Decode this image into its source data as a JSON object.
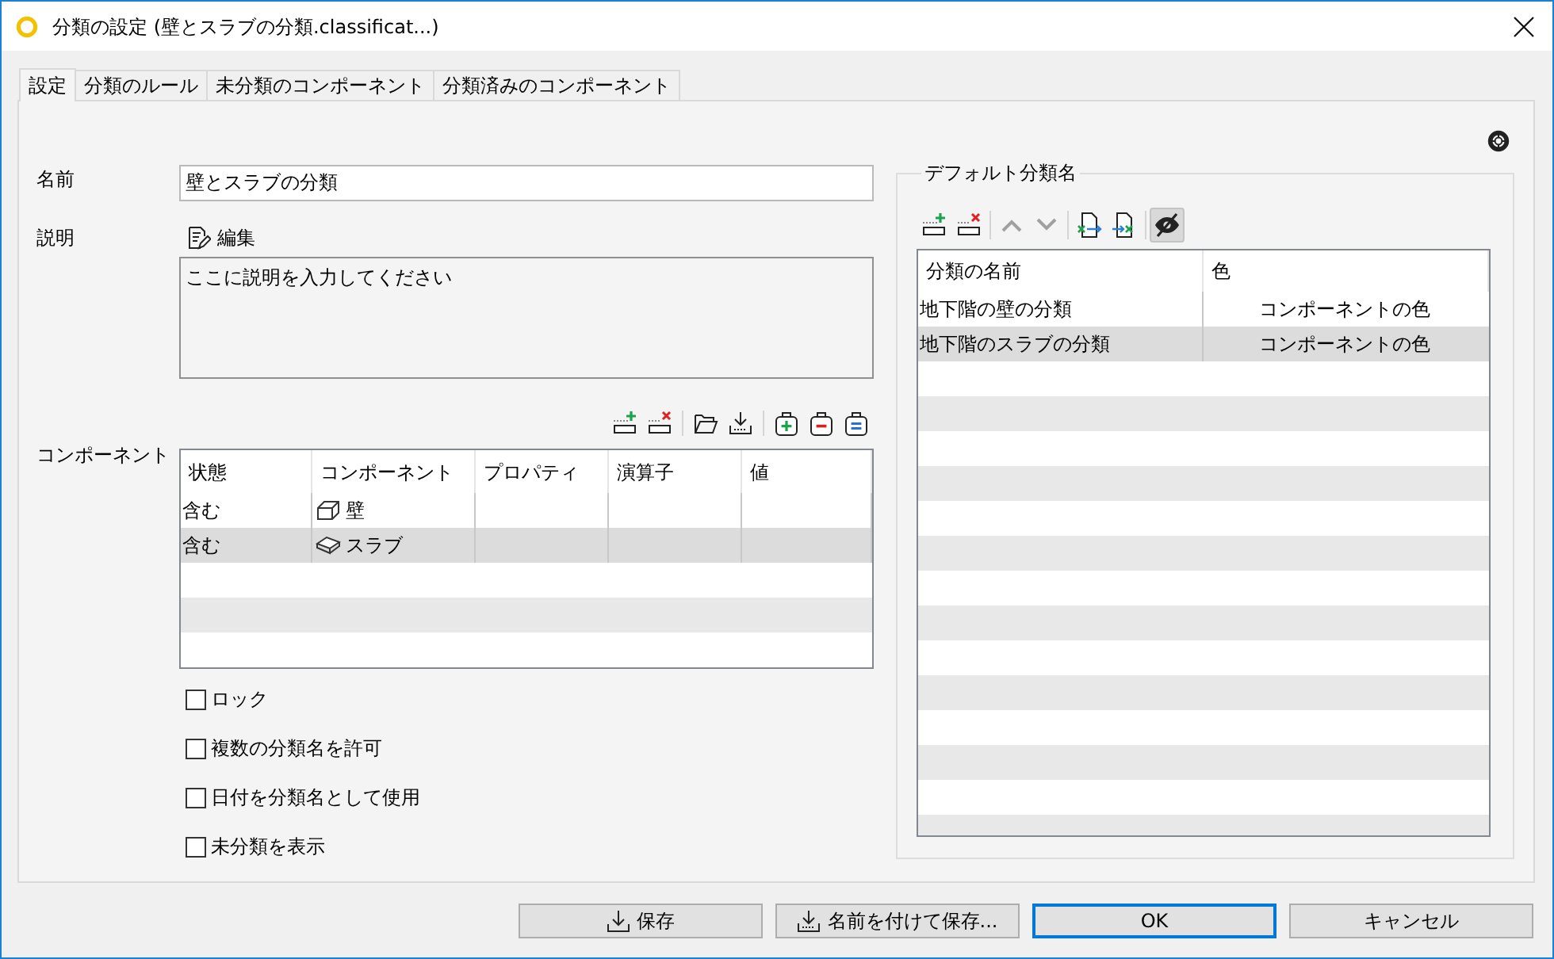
{
  "window": {
    "title": "分類の設定 (壁とスラブの分類.classificat...)"
  },
  "tabs": [
    {
      "label": "設定",
      "selected": true
    },
    {
      "label": "分類のルール",
      "selected": false
    },
    {
      "label": "未分類のコンポーネント",
      "selected": false
    },
    {
      "label": "分類済みのコンポーネント",
      "selected": false
    }
  ],
  "settings": {
    "name": {
      "label": "名前",
      "value": "壁とスラブの分類"
    },
    "description": {
      "label": "説明",
      "edit_button": "編集",
      "value": "ここに説明を入力してください"
    },
    "components": {
      "label": "コンポーネント",
      "columns": [
        "状態",
        "コンポーネント",
        "プロパティ",
        "演算子",
        "値"
      ],
      "rows": [
        {
          "state": "含む",
          "component": "壁",
          "kind": "wall",
          "selected": false
        },
        {
          "state": "含む",
          "component": "スラブ",
          "kind": "slab",
          "selected": true
        }
      ]
    },
    "options": [
      {
        "label": "ロック",
        "checked": false
      },
      {
        "label": "複数の分類名を許可",
        "checked": false
      },
      {
        "label": "日付を分類名として使用",
        "checked": false
      },
      {
        "label": "未分類を表示",
        "checked": false
      }
    ]
  },
  "default_names": {
    "title": "デフォルト分類名",
    "toolbar": {
      "move_up_disabled": true,
      "move_down_disabled": true,
      "visibility_pressed": true
    },
    "columns": [
      "分類の名前",
      "色"
    ],
    "rows": [
      {
        "name": "地下階の壁の分類",
        "color_mode": "コンポーネントの色",
        "selected": false
      },
      {
        "name": "地下階のスラブの分類",
        "color_mode": "コンポーネントの色",
        "selected": true
      }
    ]
  },
  "buttons": [
    {
      "label": "保存",
      "kind": "save",
      "focused": false
    },
    {
      "label": "名前を付けて保存...",
      "kind": "save-as",
      "focused": false
    },
    {
      "label": "OK",
      "kind": "ok",
      "focused": true
    },
    {
      "label": "キャンセル",
      "kind": "cancel",
      "focused": false
    }
  ]
}
